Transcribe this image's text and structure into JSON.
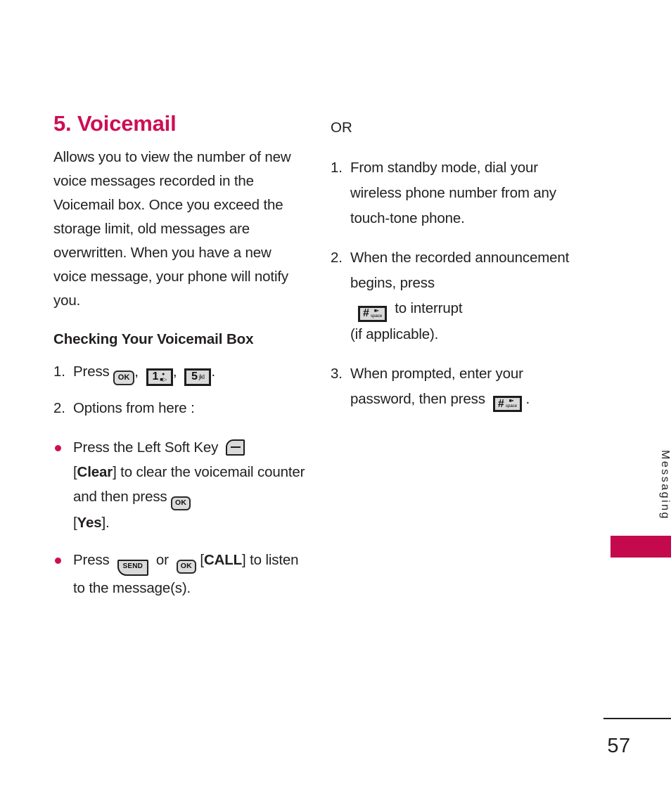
{
  "document": {
    "page_number": "57",
    "side_tab_label": "Messaging",
    "accent_color": "#cc0f54",
    "tab_color": "#c40a4d"
  },
  "left_column": {
    "heading": "5. Voicemail",
    "intro": "Allows you to view the number of new voice messages recorded in the Voicemail box. Once you exceed the storage limit, old messages are overwritten. When you have a new voice message, your phone will notify you.",
    "subheading": "Checking Your Voicemail Box",
    "steps": [
      {
        "number": "1.",
        "text_before": "Press",
        "comma_1": ",",
        "comma_2": ",",
        "period": ".",
        "keys": [
          "ok-key",
          "1-voicemail-key",
          "5-jkl-key"
        ]
      },
      {
        "number": "2.",
        "text": "Options from here :"
      }
    ],
    "bullets": [
      {
        "part_1": "Press the Left Soft Key",
        "key_1": "left-soft-key",
        "bracket_open_1": "[",
        "bold_1": "Clear",
        "bracket_close_1": "]",
        "part_2": "to clear the voicemail counter and then press",
        "key_2": "ok-key",
        "bracket_open_2": "[",
        "bold_2": "Yes",
        "bracket_close_2": "].",
        "part_3": ""
      },
      {
        "part_1": "Press",
        "key_1": "send-key",
        "conjunction": "or",
        "key_2": "ok-key",
        "bracket_open_1": "[",
        "bold_1": "CALL",
        "bracket_close_1": "]",
        "part_2": "to listen to the message(s).",
        "part_3": ""
      }
    ]
  },
  "right_column": {
    "or_label": "OR",
    "steps": [
      {
        "number": "1.",
        "text": "From standby mode, dial your wireless phone number from any touch-tone phone."
      },
      {
        "number": "2.",
        "text_before": "When the recorded announcement begins, press",
        "key": "hash-space-key",
        "text_after": "to interrupt",
        "text_last_line": "(if applicable)."
      },
      {
        "number": "3.",
        "text_before": "When prompted, enter your password, then press",
        "key": "hash-space-key",
        "period": "."
      }
    ]
  },
  "keys": {
    "ok": "OK",
    "send": "SEND",
    "digit_1": "1",
    "digit_5": "5",
    "letters_jkl": "jkl",
    "hash": "#",
    "space": "space"
  }
}
